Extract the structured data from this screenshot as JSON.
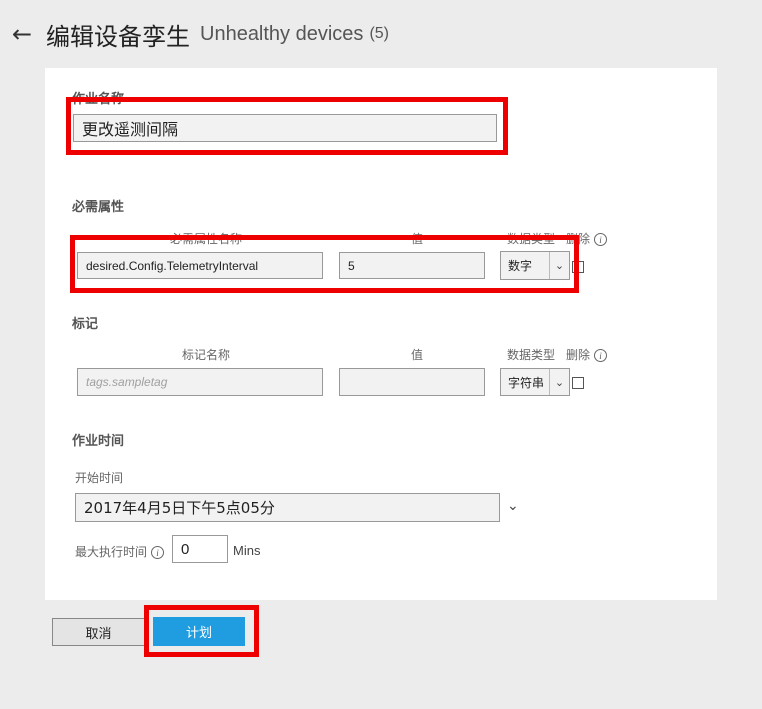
{
  "header": {
    "back_icon": "arrow-left-icon",
    "title": "编辑设备孪生",
    "subtitle": "Unhealthy devices",
    "count": "(5)"
  },
  "job_name": {
    "label": "作业名称",
    "value": "更改遥测间隔"
  },
  "required_properties": {
    "label": "必需属性",
    "col_name": "必需属性名称",
    "col_value": "值",
    "col_type": "数据类型",
    "col_delete": "删除",
    "row": {
      "name": "desired.Config.TelemetryInterval",
      "value": "5",
      "type": "数字"
    }
  },
  "tags": {
    "label": "标记",
    "col_name": "标记名称",
    "col_value": "值",
    "col_type": "数据类型",
    "col_delete": "删除",
    "row": {
      "name_placeholder": "tags.sampletag",
      "value": "",
      "type": "字符串"
    }
  },
  "job_time": {
    "label": "作业时间",
    "start_label": "开始时间",
    "start_value": "2017年4月5日下午5点05分",
    "max_exec_label": "最大执行时间",
    "max_exec_value": "0",
    "max_exec_unit": "Mins"
  },
  "buttons": {
    "cancel": "取消",
    "schedule": "计划"
  },
  "colors": {
    "accent": "#1f9de0",
    "highlight": "#ee0000",
    "page_bg": "#ececec"
  }
}
